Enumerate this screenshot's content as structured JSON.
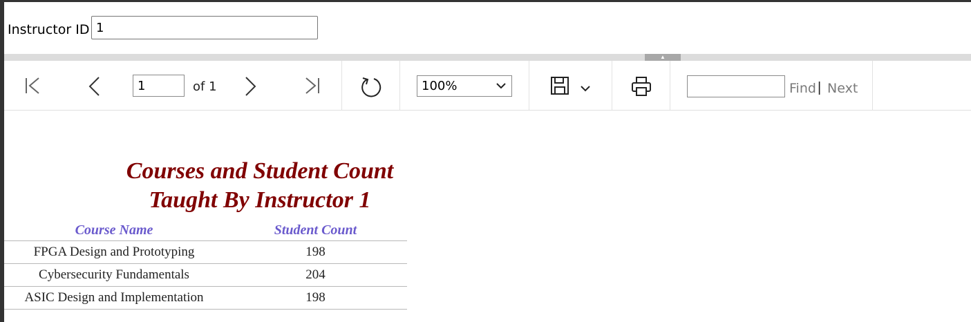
{
  "parameters": {
    "instructor_id_label": "Instructor ID",
    "instructor_id_value": "1"
  },
  "toolbar": {
    "current_page": "1",
    "of_text": "of 1",
    "zoom": "100%",
    "find_label": "Find",
    "find_separator": "|",
    "next_label": "Next",
    "find_value": ""
  },
  "report": {
    "title_line1": "Courses and Student Count",
    "title_line2": "Taught By Instructor 1",
    "columns": [
      "Course Name",
      "Student Count"
    ],
    "rows": [
      {
        "course": "FPGA Design and Prototyping",
        "count": "198"
      },
      {
        "course": "Cybersecurity Fundamentals",
        "count": "204"
      },
      {
        "course": "ASIC Design and Implementation",
        "count": "198"
      }
    ]
  },
  "colors": {
    "title": "#800000",
    "column_header": "#6a5acd",
    "splitter": "#dcdcdc"
  },
  "icons": [
    "first-page-icon",
    "previous-page-icon",
    "next-page-icon",
    "last-page-icon",
    "refresh-icon",
    "save-icon",
    "chevron-down-icon",
    "print-icon"
  ]
}
